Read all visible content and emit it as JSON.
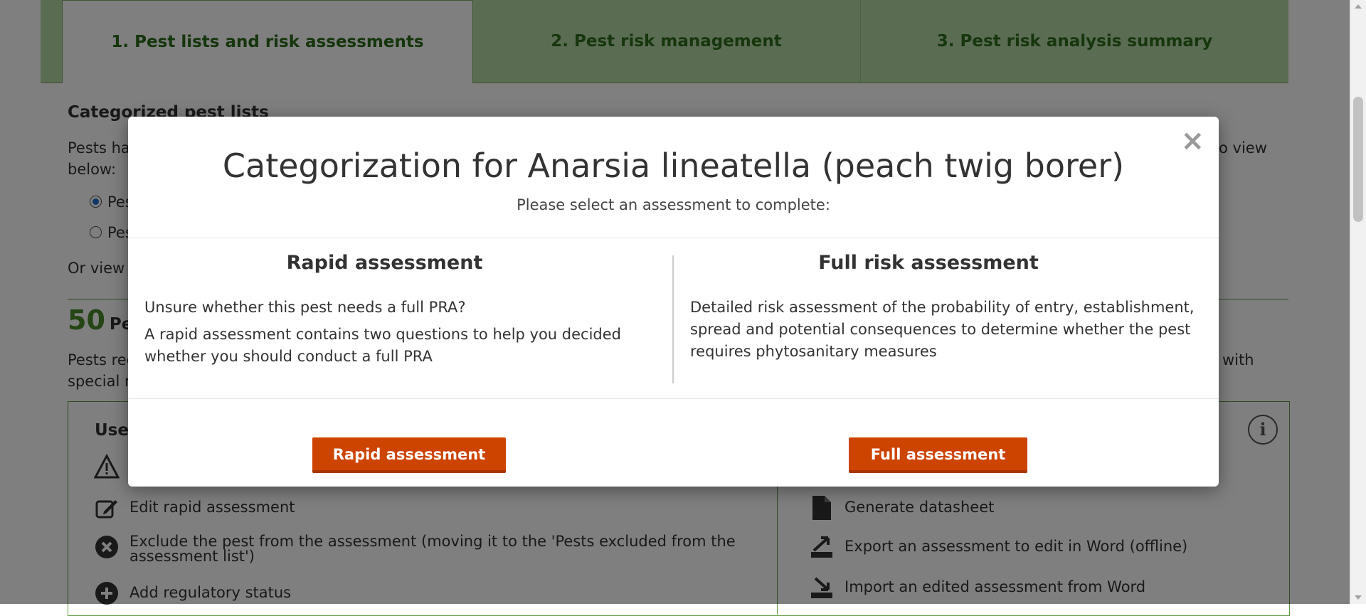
{
  "tabs": [
    {
      "label": "1. Pest lists and risk assessments"
    },
    {
      "label": "2. Pest risk management"
    },
    {
      "label": "3. Pest risk analysis summary"
    }
  ],
  "background": {
    "section_title": "Categorized pest lists",
    "intro_line1": "Pests hav",
    "intro_line1_end": "o view",
    "intro_line2": "below:",
    "radio1": "Pes",
    "radio2": "Pes",
    "or_view": "Or view b",
    "count": "50",
    "count_label": "Pes",
    "pests_req": "Pests req",
    "pests_req_end": "with",
    "special": "special re",
    "use_heading": "Use",
    "icons": {
      "edit_rapid": "Edit rapid assessment",
      "exclude_line1": "Exclude the pest from the assessment (moving it to the 'Pests excluded from the",
      "exclude_line2": "assessment list')",
      "add_reg": "Add regulatory status",
      "generate": "Generate datasheet",
      "export": "Export an assessment to edit in Word (offline)",
      "import": "Import an edited assessment from Word"
    },
    "info": "i"
  },
  "modal": {
    "close": "×",
    "title": "Categorization for Anarsia lineatella (peach twig borer)",
    "subtitle": "Please select an assessment to complete:",
    "rapid": {
      "title": "Rapid assessment",
      "p1": "Unsure whether this pest needs a full PRA?",
      "p2": "A rapid assessment contains two questions to help you decided whether you should conduct a full PRA",
      "button": "Rapid assessment"
    },
    "full": {
      "title": "Full risk assessment",
      "p1": "Detailed risk assessment of the probability of entry, establishment, spread and potential consequences to determine whether the pest requires phytosanitary measures",
      "button": "Full assessment"
    }
  }
}
